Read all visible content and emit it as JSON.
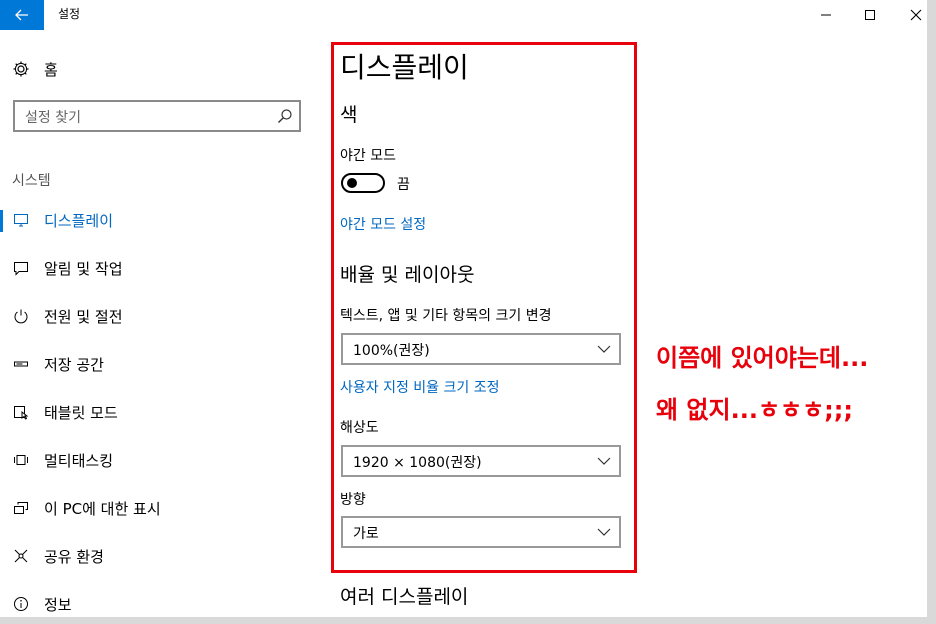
{
  "window": {
    "title": "설정"
  },
  "sidebar": {
    "home_label": "홈",
    "search_placeholder": "설정 찾기",
    "section_label": "시스템",
    "items": [
      {
        "label": "디스플레이",
        "icon": "monitor-icon",
        "active": true
      },
      {
        "label": "알림 및 작업",
        "icon": "message-icon"
      },
      {
        "label": "전원 및 절전",
        "icon": "power-icon"
      },
      {
        "label": "저장 공간",
        "icon": "storage-icon"
      },
      {
        "label": "태블릿 모드",
        "icon": "tablet-icon"
      },
      {
        "label": "멀티태스킹",
        "icon": "multitask-icon"
      },
      {
        "label": "이 PC에 대한 표시",
        "icon": "project-icon"
      },
      {
        "label": "공유 환경",
        "icon": "share-icon"
      },
      {
        "label": "정보",
        "icon": "info-icon"
      }
    ]
  },
  "main": {
    "title": "디스플레이",
    "color_heading": "색",
    "night_mode_label": "야간 모드",
    "night_mode_state": "끔",
    "night_mode_settings_link": "야간 모드 설정",
    "scale_heading": "배율 및 레이아웃",
    "scale_label": "텍스트, 앱 및 기타 항목의 크기 변경",
    "scale_value": "100%(권장)",
    "custom_scale_link": "사용자 지정 비율 크기 조정",
    "resolution_label": "해상도",
    "resolution_value": "1920 × 1080(권장)",
    "orientation_label": "방향",
    "orientation_value": "가로",
    "multi_display_heading": "여러 디스플레이"
  },
  "annotation": {
    "line1": "이쯤에 있어야는데...",
    "line2": "왜 없지...ㅎㅎㅎ;;;",
    "color": "#e8000b"
  },
  "colors": {
    "accent": "#0078d7",
    "link": "#0067c0"
  }
}
